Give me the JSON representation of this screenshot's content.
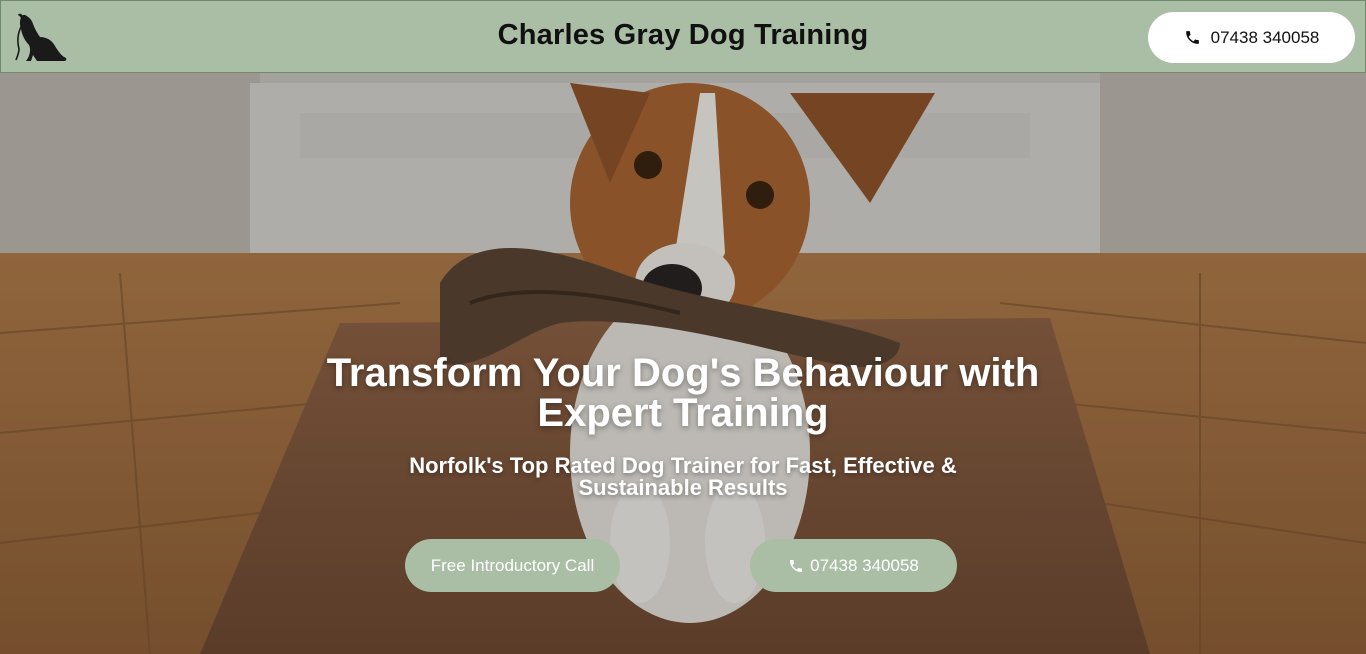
{
  "header": {
    "title": "Charles Gray Dog Training",
    "phone_label": "07438 340058",
    "logo_icon": "dog-silhouette-icon",
    "phone_icon": "phone-icon",
    "background_color": "#a9bea5"
  },
  "hero": {
    "title": "Transform Your Dog's Behaviour with Expert Training",
    "subtitle": "Norfolk's Top Rated Dog Trainer for Fast, Effective & Sustainable Results",
    "primary_button_label": "Free Introductory Call",
    "phone_button_label": "07438 340058",
    "button_color": "#a9bea5"
  }
}
